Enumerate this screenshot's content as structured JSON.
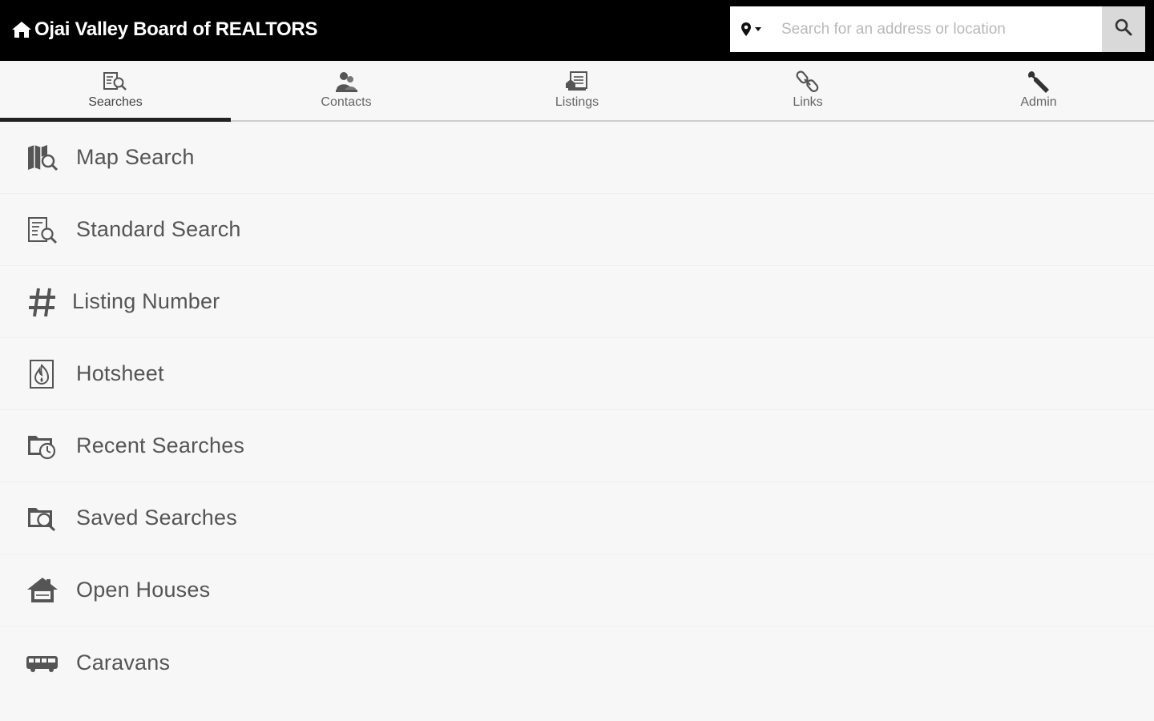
{
  "header": {
    "title": "Ojai Valley Board of REALTORS",
    "search": {
      "placeholder": "Search for an address or location",
      "value": ""
    }
  },
  "tabs": [
    {
      "label": "Searches",
      "icon": "searches-icon",
      "active": true
    },
    {
      "label": "Contacts",
      "icon": "contacts-icon",
      "active": false
    },
    {
      "label": "Listings",
      "icon": "listings-icon",
      "active": false
    },
    {
      "label": "Links",
      "icon": "links-icon",
      "active": false
    },
    {
      "label": "Admin",
      "icon": "wrench-icon",
      "active": false
    }
  ],
  "menu": [
    {
      "label": "Map Search",
      "icon": "map-search-icon"
    },
    {
      "label": "Standard Search",
      "icon": "standard-search-icon"
    },
    {
      "label": "Listing Number",
      "icon": "hash-icon"
    },
    {
      "label": "Hotsheet",
      "icon": "hotsheet-icon"
    },
    {
      "label": "Recent Searches",
      "icon": "recent-searches-icon"
    },
    {
      "label": "Saved Searches",
      "icon": "saved-searches-icon"
    },
    {
      "label": "Open Houses",
      "icon": "open-house-icon"
    },
    {
      "label": "Caravans",
      "icon": "caravan-icon"
    }
  ],
  "colors": {
    "header_bg": "#000000",
    "page_bg": "#f7f7f7",
    "active_tab_underline": "#222222",
    "search_button_bg": "#d9d9d9"
  }
}
